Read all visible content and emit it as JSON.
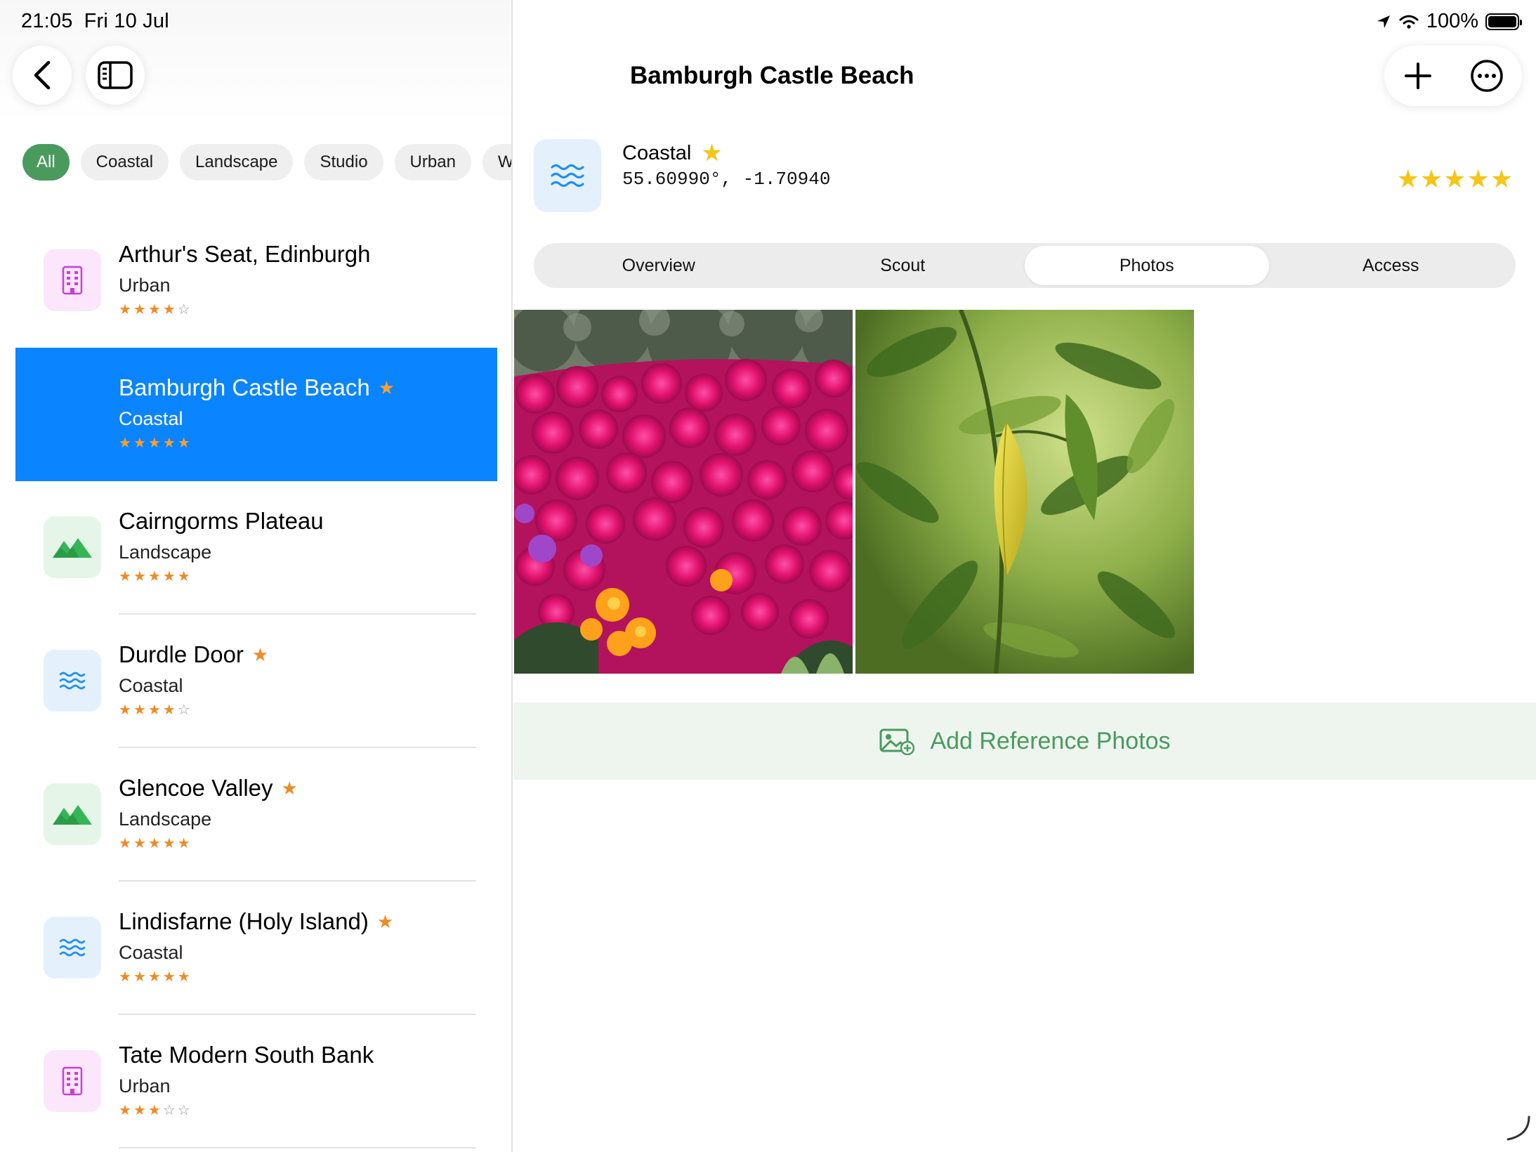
{
  "status_bar": {
    "time": "21:05",
    "date": "Fri 10 Jul",
    "battery": "100%"
  },
  "filters": [
    "All",
    "Coastal",
    "Landscape",
    "Studio",
    "Urban",
    "W"
  ],
  "locations": [
    {
      "name": "Arthur's Seat, Edinburgh",
      "category": "Urban",
      "rating": 4,
      "favorite": false,
      "icon": "building-icon"
    },
    {
      "name": "Bamburgh Castle Beach",
      "category": "Coastal",
      "rating": 5,
      "favorite": true,
      "icon": "waves-icon",
      "selected": true
    },
    {
      "name": "Cairngorms Plateau",
      "category": "Landscape",
      "rating": 5,
      "favorite": false,
      "icon": "mountain-icon"
    },
    {
      "name": "Durdle Door",
      "category": "Coastal",
      "rating": 4,
      "favorite": true,
      "icon": "waves-icon"
    },
    {
      "name": "Glencoe Valley",
      "category": "Landscape",
      "rating": 5,
      "favorite": true,
      "icon": "mountain-icon"
    },
    {
      "name": "Lindisfarne (Holy Island)",
      "category": "Coastal",
      "rating": 5,
      "favorite": true,
      "icon": "waves-icon"
    },
    {
      "name": "Tate Modern South Bank",
      "category": "Urban",
      "rating": 3,
      "favorite": false,
      "icon": "building-icon"
    }
  ],
  "detail": {
    "title": "Bamburgh Castle Beach",
    "category": "Coastal",
    "coordinates": "55.60990°, -1.70940",
    "rating": 5,
    "tabs": [
      "Overview",
      "Scout",
      "Photos",
      "Access"
    ],
    "active_tab": "Photos",
    "add_photos_label": "Add Reference Photos"
  },
  "colors": {
    "accent_green": "#4a9a5e",
    "selection_blue": "#0a84ff",
    "star_orange": "#f08a24",
    "star_yellow": "#f5c518"
  }
}
